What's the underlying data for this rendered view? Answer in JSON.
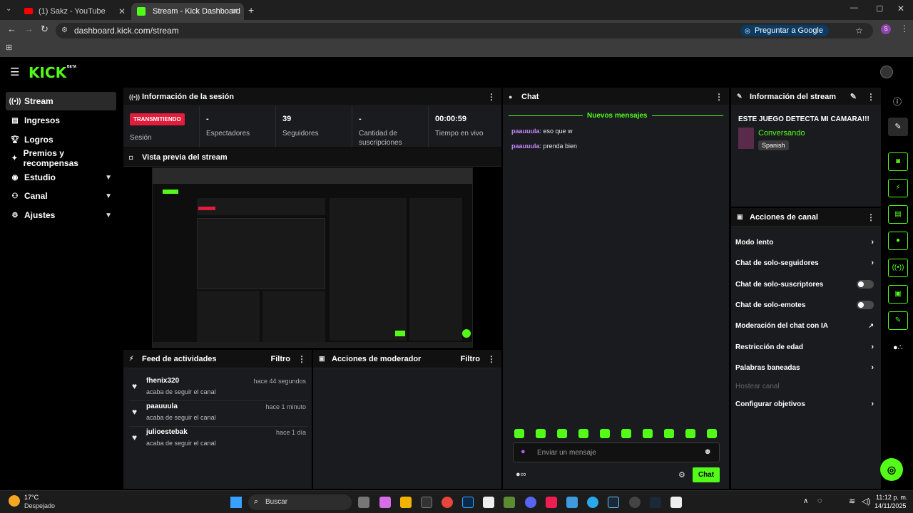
{
  "browser": {
    "tab1_title": "(1) Sakz - YouTube",
    "tab2_title": "Stream - Kick Dashboard",
    "url": "dashboard.kick.com/stream",
    "ask_google": "Preguntar a Google",
    "profile": "S"
  },
  "header": {
    "logo": "KICK",
    "beta": "BETA"
  },
  "sidebar": {
    "items": [
      {
        "label": "Stream"
      },
      {
        "label": "Ingresos"
      },
      {
        "label": "Logros"
      },
      {
        "label": "Premios y recompensas"
      },
      {
        "label": "Estudio"
      },
      {
        "label": "Canal"
      },
      {
        "label": "Ajustes"
      }
    ]
  },
  "session": {
    "title": "Información de la sesión",
    "status_badge": "TRANSMITIENDO",
    "status_label": "Sesión",
    "viewers_value": "-",
    "viewers_label": "Espectadores",
    "followers_value": "39",
    "followers_label": "Seguidores",
    "subs_value": "-",
    "subs_label": "Cantidad de suscripciones",
    "time_value": "00:00:59",
    "time_label": "Tiempo en vivo"
  },
  "preview": {
    "title": "Vista previa del stream"
  },
  "feed": {
    "title": "Feed de actividades",
    "filter": "Filtro",
    "items": [
      {
        "name": "fhenix320",
        "sub": "acaba de seguir el canal",
        "time": "hace 44 segundos"
      },
      {
        "name": "paauuula",
        "sub": "acaba de seguir el canal",
        "time": "hace 1 minuto"
      },
      {
        "name": "julioestebak",
        "sub": "acaba de seguir el canal",
        "time": "hace 1 día"
      }
    ]
  },
  "mod": {
    "title": "Acciones de moderador",
    "filter": "Filtro"
  },
  "chat": {
    "title": "Chat",
    "new_messages": "Nuevos mensajes",
    "messages": [
      {
        "user": "paauuula",
        "text": ": eso que w"
      },
      {
        "user": "paauuula",
        "text": ": prenda bien"
      }
    ],
    "placeholder": "Enviar un mensaje",
    "send": "Chat"
  },
  "stream_info": {
    "title": "Información del stream",
    "stream_title": "ESTE JUEGO DETECTA MI CAMARA!!!",
    "category": "Conversando",
    "language": "Spanish"
  },
  "channel_actions": {
    "title": "Acciones de canal",
    "items": [
      {
        "label": "Modo lento"
      },
      {
        "label": "Chat de solo-seguidores"
      },
      {
        "label": "Chat de solo-suscriptores"
      },
      {
        "label": "Chat de solo-emotes"
      },
      {
        "label": "Moderación del chat con IA"
      },
      {
        "label": "Restricción de edad"
      },
      {
        "label": "Palabras baneadas"
      },
      {
        "label": "Hostear canal"
      },
      {
        "label": "Configurar objetivos"
      }
    ]
  },
  "taskbar": {
    "weather_temp": "17°C",
    "weather_desc": "Despejado",
    "search": "Buscar",
    "time": "11:12 p. m.",
    "date": "14/11/2025"
  },
  "colors": {
    "accent": "#53fc18",
    "live": "#e01e3b",
    "panel": "#191b1f"
  }
}
